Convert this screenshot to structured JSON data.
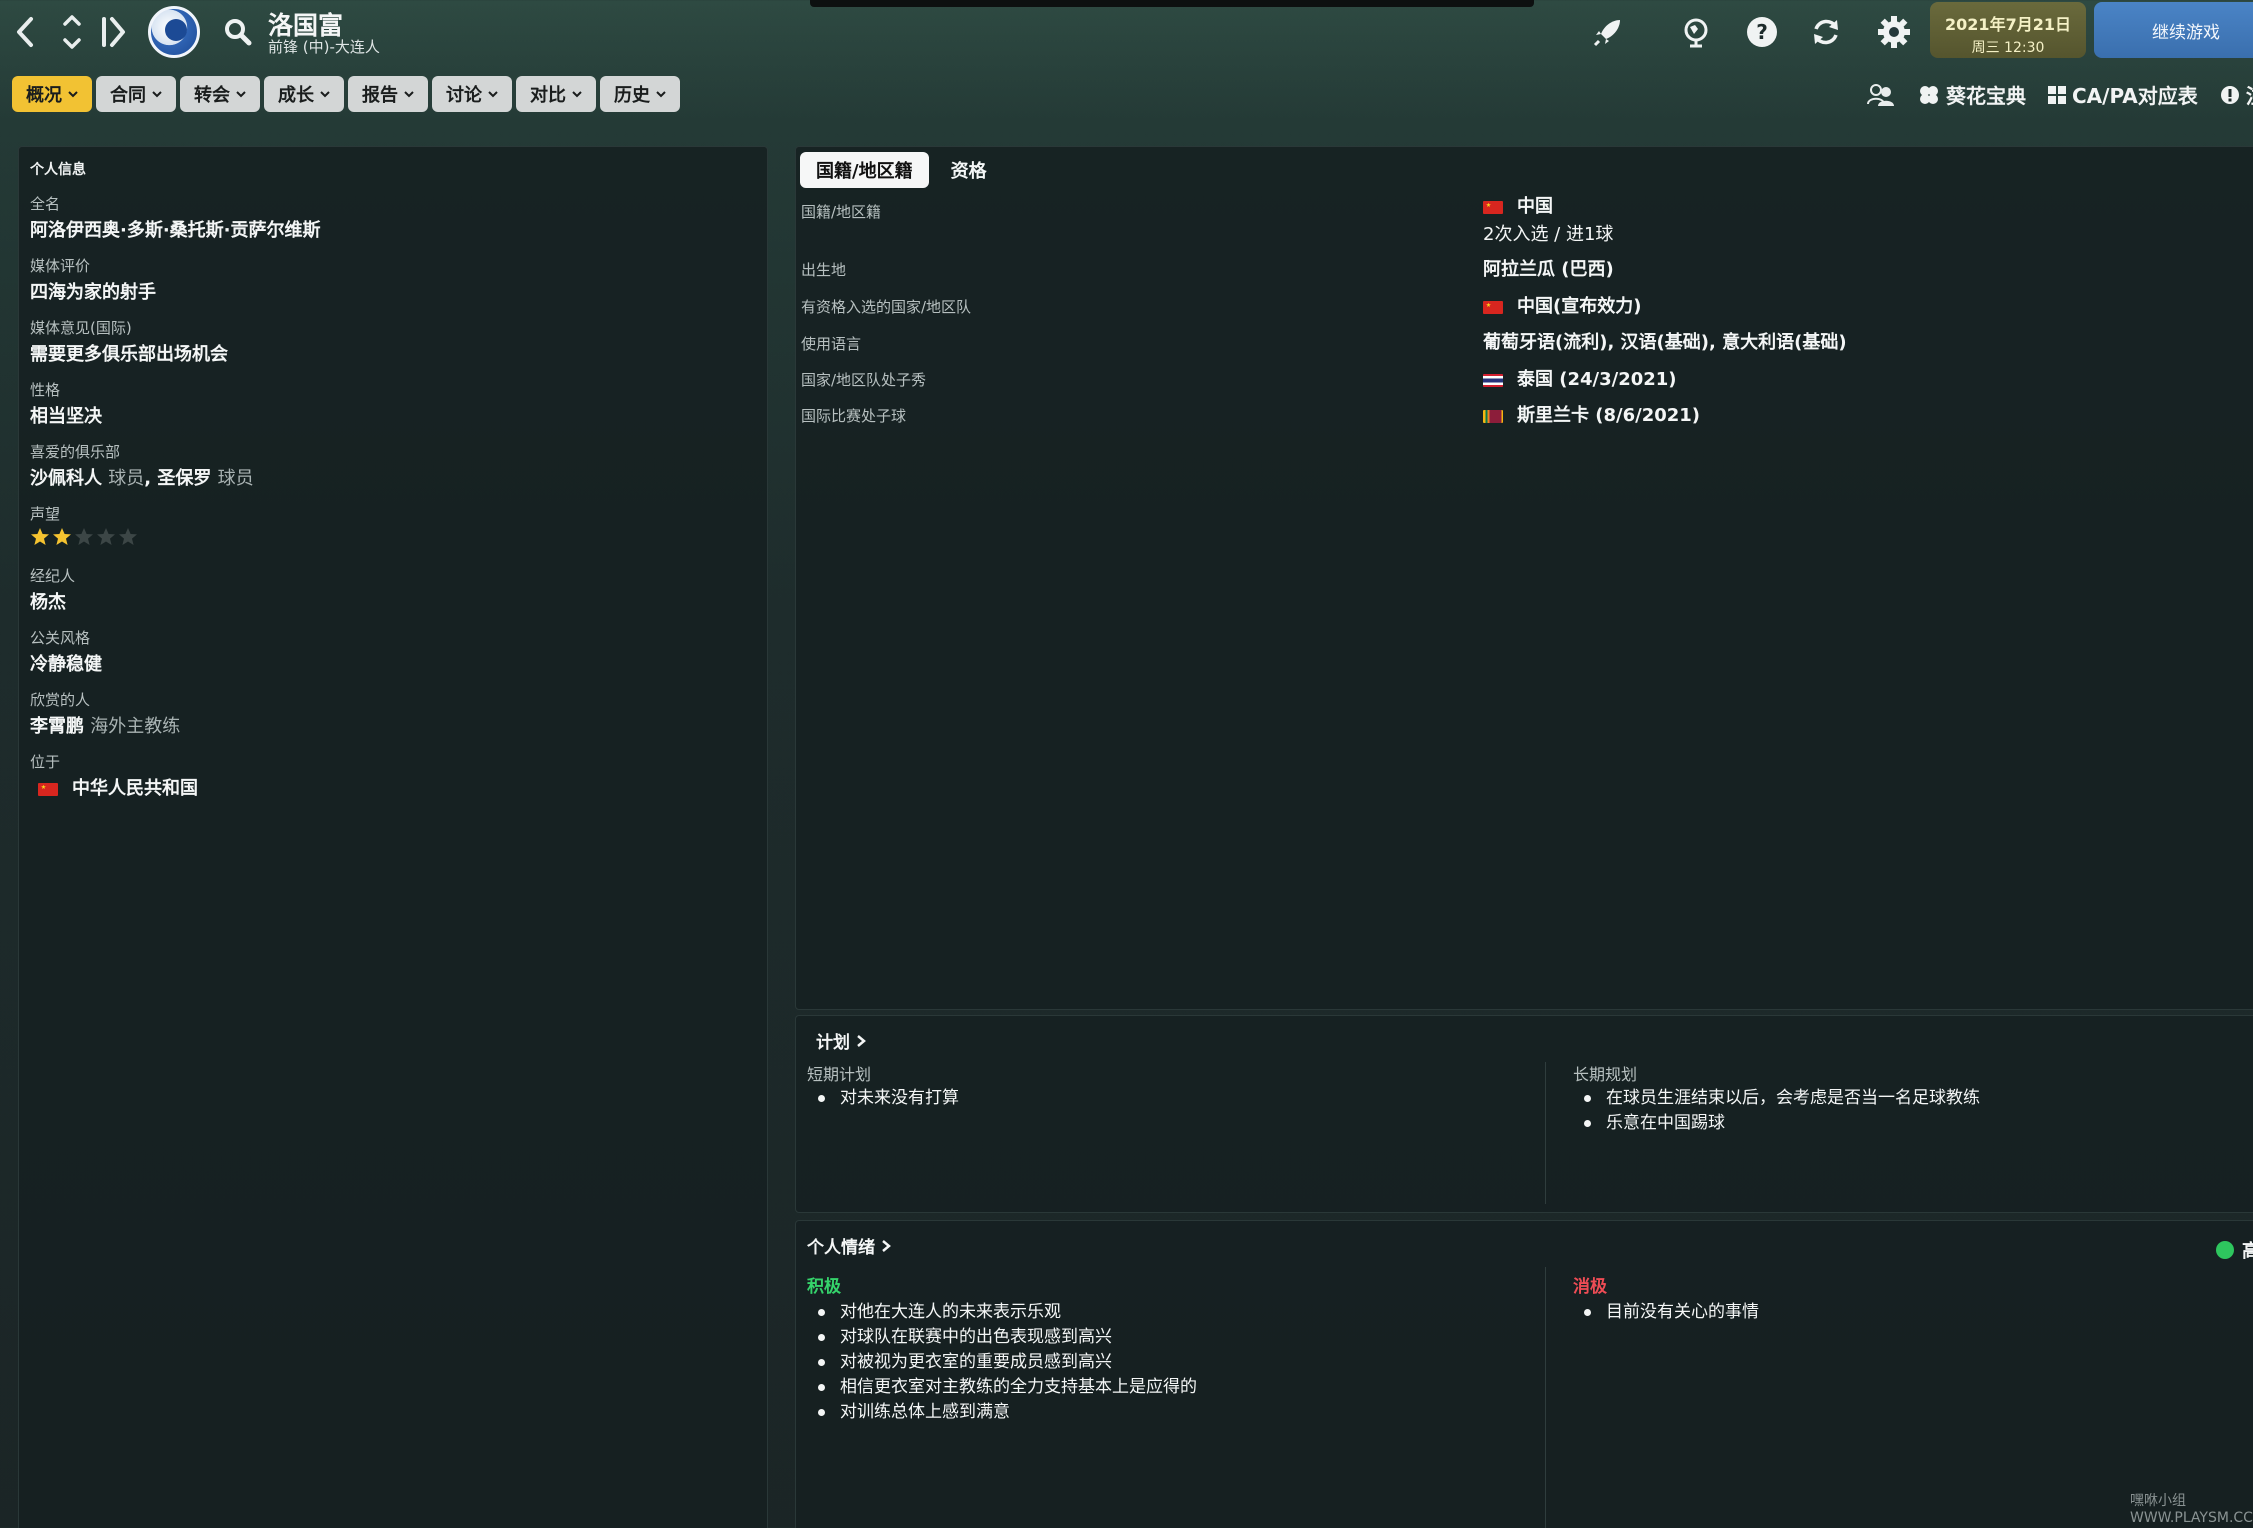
{
  "header": {
    "player_name": "洛国富",
    "player_subtitle": "前锋 (中)-大连人",
    "date": "2021年7月21日",
    "weekday_time": "周三 12:30",
    "continue_label": "继续游戏"
  },
  "menu": {
    "tabs": [
      {
        "label": "概况"
      },
      {
        "label": "合同"
      },
      {
        "label": "转会"
      },
      {
        "label": "成长"
      },
      {
        "label": "报告"
      },
      {
        "label": "讨论"
      },
      {
        "label": "对比"
      },
      {
        "label": "历史"
      }
    ],
    "right_links": [
      {
        "label": "葵花宝典"
      },
      {
        "label": "CA/PA对应表"
      },
      {
        "label": "注册"
      }
    ]
  },
  "personal": {
    "title": "个人信息",
    "fullname_label": "全名",
    "fullname": "阿洛伊西奥·多斯·桑托斯·贡萨尔维斯",
    "media_label": "媒体评价",
    "media": "四海为家的射手",
    "opinion_label": "媒体意见(国际)",
    "opinion": "需要更多俱乐部出场机会",
    "personality_label": "性格",
    "personality": "相当坚决",
    "fav_clubs_label": "喜爱的俱乐部",
    "fav_club_1": "沙佩科人",
    "fav_club_1_role": "球员",
    "fav_club_2": "圣保罗",
    "fav_club_2_role": "球员",
    "reputation_label": "声望",
    "reputation_stars": 2,
    "reputation_max": 5,
    "agent_label": "经纪人",
    "agent": "杨杰",
    "pr_label": "公关风格",
    "pr": "冷静稳健",
    "admires_label": "欣赏的人",
    "admires": "李霄鹏",
    "admires_role": "海外主教练",
    "located_label": "位于",
    "located": "中华人民共和国"
  },
  "nationality": {
    "tabs": [
      {
        "label": "国籍/地区籍"
      },
      {
        "label": "资格"
      }
    ],
    "rows": [
      {
        "label": "国籍/地区籍",
        "value": "中国",
        "flag": "cn"
      },
      {
        "label": "出生地",
        "value": "阿拉兰瓜 (巴西)"
      },
      {
        "label": "有资格入选的国家/地区队",
        "value": "中国(宣布效力)",
        "flag": "cn"
      },
      {
        "label": "使用语言",
        "value": "葡萄牙语(流利), 汉语(基础), 意大利语(基础)"
      },
      {
        "label": "国家/地区队处子秀",
        "value": "泰国 (24/3/2021)",
        "flag": "th"
      },
      {
        "label": "国际比赛处子球",
        "value": "斯里兰卡 (8/6/2021)",
        "flag": "lk"
      }
    ],
    "caps": "2次入选 / 进1球"
  },
  "plan": {
    "title": "计划",
    "short_label": "短期计划",
    "short_items": [
      "对未来没有打算"
    ],
    "long_label": "长期规划",
    "long_items": [
      "在球员生涯结束以后，会考虑是否当一名足球教练",
      "乐意在中国踢球"
    ]
  },
  "mood": {
    "title": "个人情绪",
    "indicator": "高",
    "positive_label": "积极",
    "positive_items": [
      "对他在大连人的未来表示乐观",
      "对球队在联赛中的出色表现感到高兴",
      "对被视为更衣室的重要成员感到高兴",
      "相信更衣室对主教练的全力支持基本上是应得的",
      "对训练总体上感到满意"
    ],
    "negative_label": "消极",
    "negative_items": [
      "目前没有关心的事情"
    ]
  },
  "watermark": "嘿咻小组 WWW.PLAYSM.CC",
  "colors": {
    "accent_tab": "#f2c233",
    "continue": "#4a84c6",
    "date": "#6a6a3c",
    "positive": "#35d36b",
    "negative": "#ee4c55"
  }
}
